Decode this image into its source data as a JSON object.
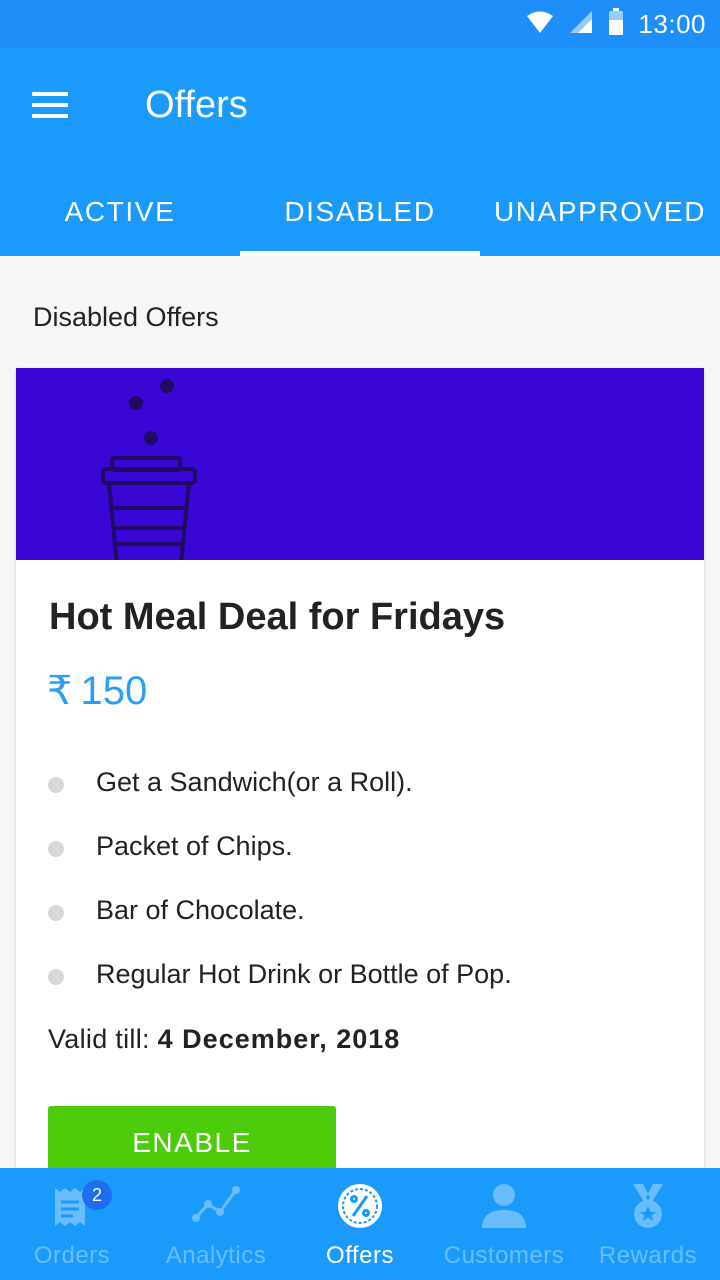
{
  "status_bar": {
    "time": "13:00",
    "icons": [
      "wifi-icon",
      "signal-icon",
      "battery-icon"
    ]
  },
  "app_bar": {
    "title": "Offers",
    "menu_icon": "menu-icon"
  },
  "tabs": [
    {
      "label": "ACTIVE",
      "selected": false
    },
    {
      "label": "DISABLED",
      "selected": true
    },
    {
      "label": "UNAPPROVED",
      "selected": false
    }
  ],
  "section": {
    "title": "Disabled Offers"
  },
  "offer": {
    "banner_icon": "coffee-cup-icon",
    "banner_color": "#3a06d6",
    "name": "Hot Meal Deal for Fridays",
    "currency": "₹",
    "price": "150",
    "items": [
      "Get a Sandwich(or a Roll).",
      "Packet of Chips.",
      "Bar of Chocolate.",
      "Regular Hot Drink or Bottle of Pop."
    ],
    "valid_label": "Valid till:",
    "valid_date": "4 December, 2018",
    "enable_label": "ENABLE",
    "enable_color": "#4ccb0a"
  },
  "bottom_nav": [
    {
      "label": "Orders",
      "icon": "receipt-icon",
      "badge": "2",
      "selected": false
    },
    {
      "label": "Analytics",
      "icon": "analytics-icon",
      "selected": false
    },
    {
      "label": "Offers",
      "icon": "percent-badge-icon",
      "selected": true
    },
    {
      "label": "Customers",
      "icon": "person-icon",
      "selected": false
    },
    {
      "label": "Rewards",
      "icon": "medal-icon",
      "selected": false
    }
  ],
  "colors": {
    "primary": "#1a9bfb",
    "status_bar": "#1e8ff8",
    "price": "#2b9ef5"
  }
}
